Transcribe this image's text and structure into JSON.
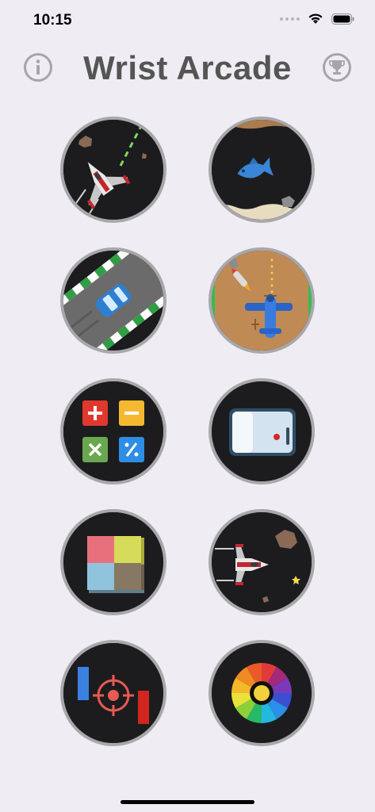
{
  "status_bar": {
    "time": "10:15"
  },
  "header": {
    "title": "Wrist Arcade",
    "info_icon": "info-icon",
    "trophy_icon": "trophy-icon"
  },
  "games": [
    {
      "icon": "space-shooter-diagonal-icon"
    },
    {
      "icon": "fish-swim-icon"
    },
    {
      "icon": "car-racing-icon"
    },
    {
      "icon": "biplane-shooter-icon"
    },
    {
      "icon": "math-operations-icon"
    },
    {
      "icon": "pong-paddle-icon"
    },
    {
      "icon": "color-blocks-icon"
    },
    {
      "icon": "space-shooter-horizontal-icon"
    },
    {
      "icon": "target-crosshair-icon"
    },
    {
      "icon": "color-wheel-icon"
    }
  ],
  "colors": {
    "background": "#efedf3",
    "title": "#555555",
    "tile_bg": "#1c1c1e",
    "tile_border": "#a8a8ab"
  }
}
